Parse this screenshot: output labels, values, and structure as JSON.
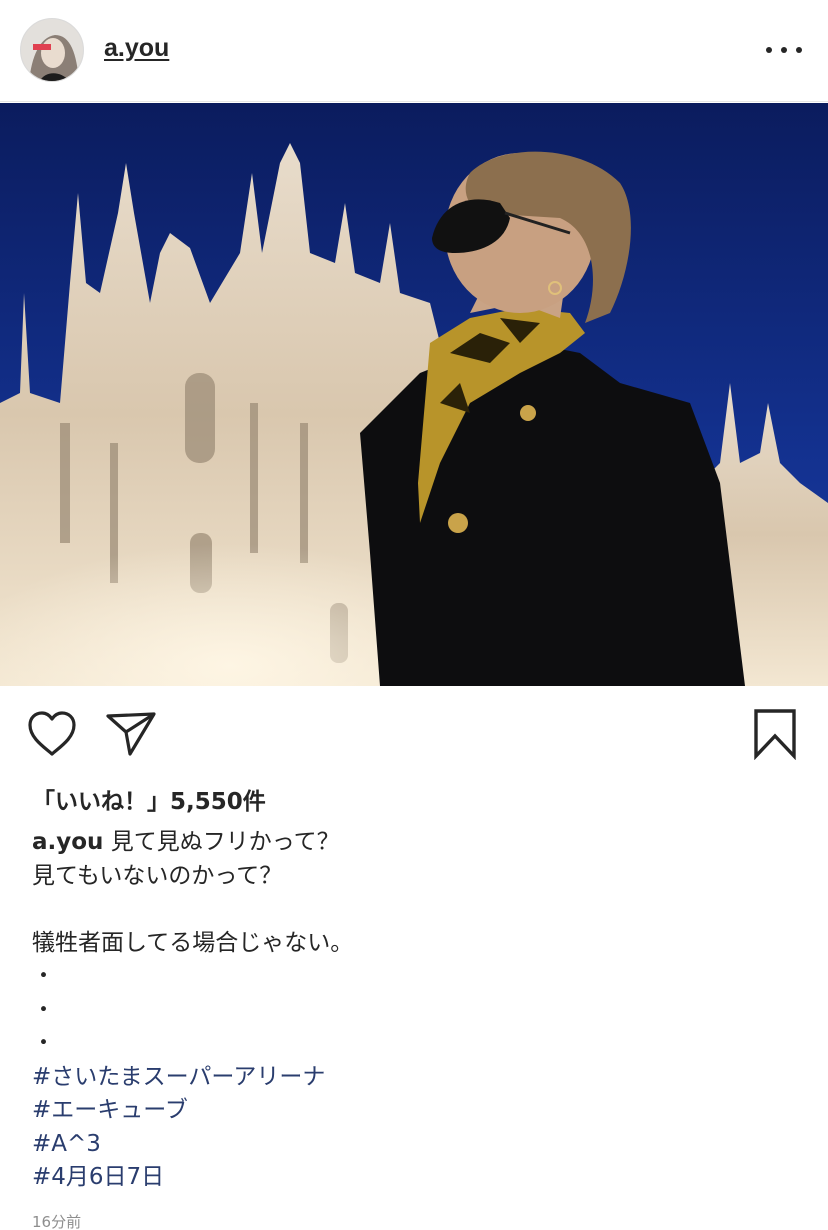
{
  "post": {
    "username": "a.you",
    "likes_label": "「いいね！」5,550件",
    "caption": {
      "username": "a.you",
      "first_line": "見て見ぬフリかって？",
      "lines": [
        "見てもいないのかって？",
        "",
        "犠牲者面してる場合じゃない。",
        "・",
        "・",
        "・"
      ],
      "hashtags": [
        "#さいたまスーパーアリーナ",
        "#エーキューブ",
        "#A^3",
        "#4月6日7日"
      ]
    },
    "timestamp": "16分前"
  },
  "icons": {
    "more": "more-horizontal-icon",
    "like": "heart-icon",
    "share": "paper-plane-icon",
    "save": "bookmark-icon"
  },
  "colors": {
    "text": "#262626",
    "hashtag": "#2a3d6e",
    "muted": "#8e8e8e",
    "sky": "#112a86"
  }
}
